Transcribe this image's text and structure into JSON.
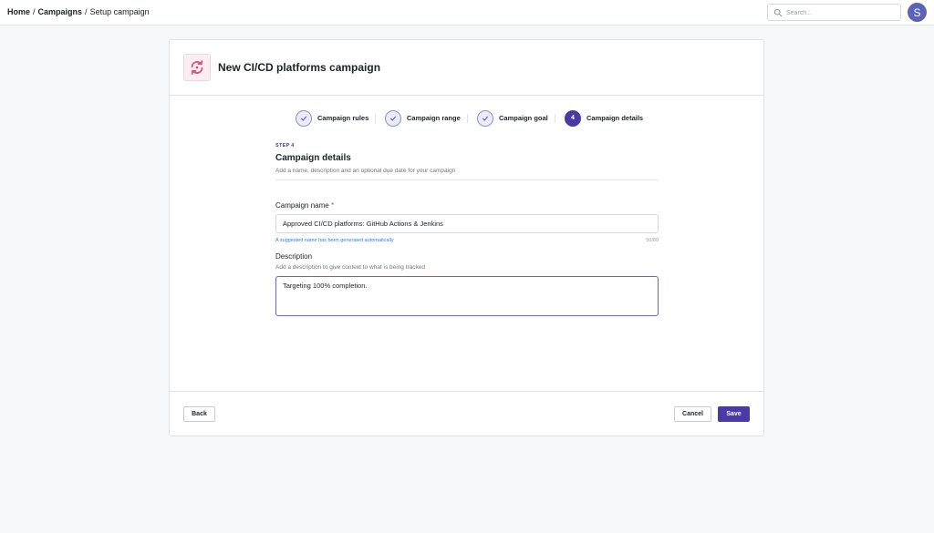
{
  "breadcrumb": {
    "home": "Home",
    "sep1": "/",
    "campaigns": "Campaigns",
    "sep2": "/",
    "current": "Setup campaign"
  },
  "search": {
    "placeholder": "Search..."
  },
  "user": {
    "avatar_initial": "S"
  },
  "campaign": {
    "title": "New CI/CD platforms campaign"
  },
  "steps": [
    {
      "label": "Campaign rules",
      "state": "done"
    },
    {
      "label": "Campaign range",
      "state": "done"
    },
    {
      "label": "Campaign goal",
      "state": "done"
    },
    {
      "label": "Campaign details",
      "state": "current",
      "number": "4"
    }
  ],
  "section": {
    "step_tag": "STEP 4",
    "title": "Campaign details",
    "subtitle": "Add a name, description and an optional due date for your campaign"
  },
  "name_field": {
    "label": "Campaign name",
    "required_marker": "*",
    "value": "Approved CI/CD platforms: GitHub Actions & Jenkins",
    "hint": "A suggested name has been generated automatically",
    "counter": "50/80"
  },
  "description_field": {
    "label": "Description",
    "subtitle": "Add a description to give context to what is being tracked",
    "value": "Targeting 100% completion."
  },
  "footer": {
    "back_label": "Back",
    "cancel_label": "Cancel",
    "save_label": "Save"
  },
  "colors": {
    "accent": "#4b3aa5",
    "campaign_icon": "#d94f7c",
    "avatar": "#5b62b8",
    "hint_link": "#3d7bd9"
  },
  "icons": {
    "search": "search-icon",
    "campaign": "refresh-cycle-icon",
    "step_done": "check-icon"
  }
}
